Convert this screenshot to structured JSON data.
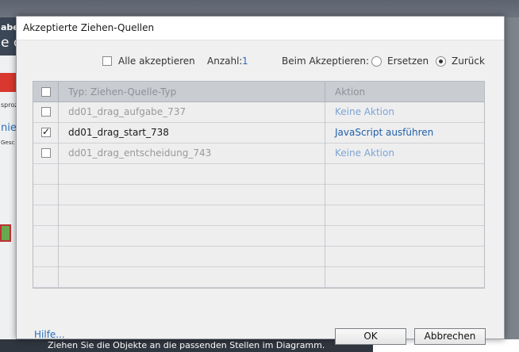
{
  "background": {
    "bottom_hint": "Ziehen Sie die Objekte an die passenden Stellen im Diagramm.",
    "side_fragments": [
      "aber",
      "e c",
      "sprozi",
      "nie",
      "Gesc"
    ]
  },
  "dialog": {
    "title": "Akzeptierte Ziehen-Quellen",
    "options": {
      "accept_all_label": "Alle akzeptieren",
      "accept_all_checked": false,
      "count_label": "Anzahl:",
      "count_value": "1",
      "on_accept_label": "Beim Akzeptieren:",
      "radio_replace_label": "Ersetzen",
      "radio_back_label": "Zurück",
      "selected_mode": "Zurück"
    },
    "table": {
      "columns": [
        "Typ: Ziehen-Quelle-Typ",
        "Aktion"
      ],
      "rows": [
        {
          "checked": false,
          "name": "dd01_drag_aufgabe_737",
          "action": "Keine Aktion"
        },
        {
          "checked": true,
          "name": "dd01_drag_start_738",
          "action": "JavaScript ausführen"
        },
        {
          "checked": false,
          "name": "dd01_drag_entscheidung_743",
          "action": "Keine Aktion"
        }
      ],
      "empty_rows": 6
    },
    "help_label": "Hilfe...",
    "ok_label": "OK",
    "cancel_label": "Abbrechen"
  }
}
